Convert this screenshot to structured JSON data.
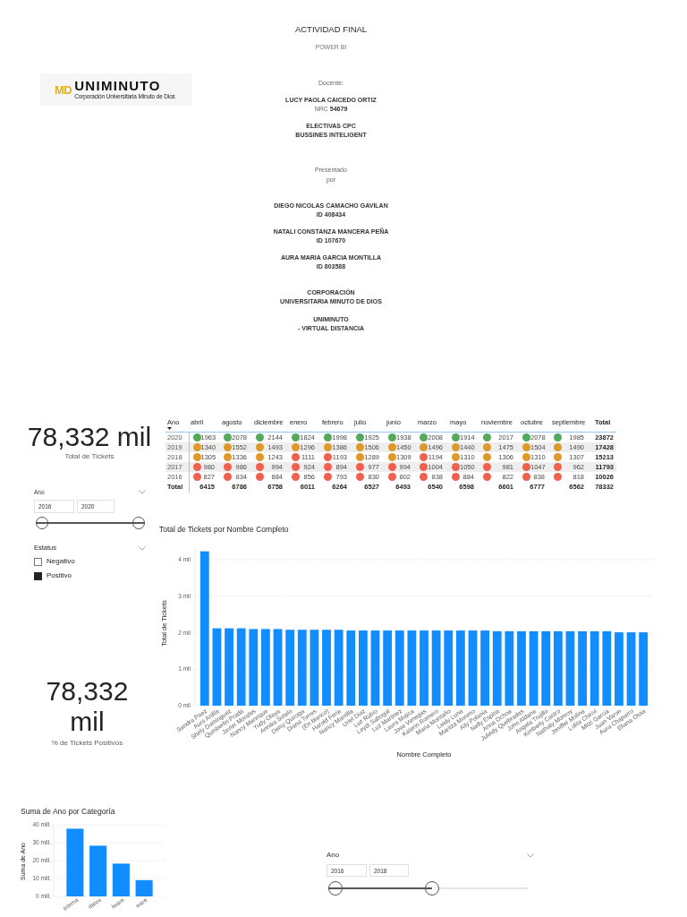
{
  "cover": {
    "logo": {
      "monogram": "MD",
      "name": "UNIMINUTO",
      "tagline": "Corporación Universitaria Minuto de Dios"
    },
    "title": "ACTIVIDAD FINAL",
    "subtitle": "POWER BI",
    "teacher": {
      "label": "Docente:",
      "name": "LUCY PAOLA CAICEDO ORTIZ",
      "nrc": "NRC **54679**"
    },
    "course": [
      "ELECTIVAS CPC",
      "BUSSINES INTELIGENT"
    ],
    "presented_by": [
      "Presentado",
      "por"
    ],
    "students": [
      {
        "name": "DIEGO NICOLAS CAMACHO GAVILAN",
        "id": "ID 408434"
      },
      {
        "name": "NATALI CONSTANZA MANCERA PEÑA",
        "id": "ID 107670"
      },
      {
        "name": "AURA MARIA GARCIA MONTILLA",
        "id": "ID 803588"
      }
    ],
    "institution": [
      "CORPORACIÓN",
      "UNIVERSITARIA MINUTO DE DIOS"
    ],
    "campus": [
      "UNIMINUTO",
      "- VIRTUAL DISTANCIA"
    ]
  },
  "kpis": [
    {
      "value": "78,332 mil",
      "label": "Total de Tickets"
    },
    {
      "value": "78,332 mil",
      "label": "% de Tickets Positivos"
    }
  ],
  "year_slicers": [
    {
      "title": "Ano",
      "from": "2016",
      "to": "2020",
      "level": 1
    },
    {
      "title": "Ano",
      "from": "2016",
      "to": "2018",
      "level": 0.5
    }
  ],
  "status_slicer": {
    "title": "Estatus",
    "options": [
      {
        "label": "Negativo",
        "checked": false
      },
      {
        "label": "Positivo",
        "checked": true
      }
    ]
  },
  "matrix": {
    "columns": [
      {
        "label": "Ano",
        "kind": "row_header",
        "sorted": true
      },
      {
        "label": "abril",
        "kind": "month",
        "sorted": false
      },
      {
        "label": "agosto",
        "kind": "month",
        "sorted": false
      },
      {
        "label": "diciembre",
        "kind": "month",
        "sorted": false
      },
      {
        "label": "enero",
        "kind": "month",
        "sorted": false
      },
      {
        "label": "febrero",
        "kind": "month",
        "sorted": false
      },
      {
        "label": "julio",
        "kind": "month",
        "sorted": false
      },
      {
        "label": "junio",
        "kind": "month",
        "sorted": false
      },
      {
        "label": "marzo",
        "kind": "month",
        "sorted": false
      },
      {
        "label": "mayo",
        "kind": "month",
        "sorted": false
      },
      {
        "label": "noviembre",
        "kind": "month",
        "sorted": false
      },
      {
        "label": "octubre",
        "kind": "month",
        "sorted": false
      },
      {
        "label": "septiembre",
        "kind": "month",
        "sorted": false
      }
    ],
    "total_column": {
      "label": "Total"
    },
    "rows": [
      {
        "cells": [
          {
            "value": "2020"
          },
          {
            "value": "1963",
            "color": "#54a95c"
          },
          {
            "value": "2078",
            "color": "#54a95c"
          },
          {
            "value": "2144",
            "color": "#54a95c"
          },
          {
            "value": "1824",
            "color": "#54a95c"
          },
          {
            "value": "1998",
            "color": "#54a95c"
          },
          {
            "value": "1925",
            "color": "#54a95c"
          },
          {
            "value": "1938",
            "color": "#54a95c"
          },
          {
            "value": "2008",
            "color": "#54a95c"
          },
          {
            "value": "1914",
            "color": "#54a95c"
          },
          {
            "value": "2017",
            "color": "#54a95c"
          },
          {
            "value": "2078",
            "color": "#54a95c"
          },
          {
            "value": "1985",
            "color": "#54a95c"
          }
        ],
        "total": "23872"
      },
      {
        "cells": [
          {
            "value": "2019"
          },
          {
            "value": "1340",
            "color": "#dd9a2a"
          },
          {
            "value": "1552",
            "color": "#dd9a2a"
          },
          {
            "value": "1493",
            "color": "#dd9a2a"
          },
          {
            "value": "1296",
            "color": "#dd9a2a"
          },
          {
            "value": "1386",
            "color": "#dd9a2a"
          },
          {
            "value": "1506",
            "color": "#dd9a2a"
          },
          {
            "value": "1450",
            "color": "#dd9a2a"
          },
          {
            "value": "1496",
            "color": "#dd9a2a"
          },
          {
            "value": "1440",
            "color": "#dd9a2a"
          },
          {
            "value": "1475",
            "color": "#dd9a2a"
          },
          {
            "value": "1504",
            "color": "#dd9a2a"
          },
          {
            "value": "1490",
            "color": "#dd9a2a"
          }
        ],
        "total": "17428"
      },
      {
        "cells": [
          {
            "value": "2018"
          },
          {
            "value": "1305",
            "color": "#dd9a2a"
          },
          {
            "value": "1336",
            "color": "#dd9a2a"
          },
          {
            "value": "1243",
            "color": "#dd9a2a"
          },
          {
            "value": "1111",
            "color": "#f0604e"
          },
          {
            "value": "1193",
            "color": "#f0604e"
          },
          {
            "value": "1289",
            "color": "#dd9a2a"
          },
          {
            "value": "1309",
            "color": "#dd9a2a"
          },
          {
            "value": "1194",
            "color": "#f0604e"
          },
          {
            "value": "1310",
            "color": "#dd9a2a"
          },
          {
            "value": "1306",
            "color": "#dd9a2a"
          },
          {
            "value": "1310",
            "color": "#dd9a2a"
          },
          {
            "value": "1307",
            "color": "#dd9a2a"
          }
        ],
        "total": "15213"
      },
      {
        "cells": [
          {
            "value": "2017"
          },
          {
            "value": "980",
            "color": "#f0604e"
          },
          {
            "value": "986",
            "color": "#f0604e"
          },
          {
            "value": "994",
            "color": "#f0604e"
          },
          {
            "value": "924",
            "color": "#f0604e"
          },
          {
            "value": "894",
            "color": "#f0604e"
          },
          {
            "value": "977",
            "color": "#f0604e"
          },
          {
            "value": "994",
            "color": "#f0604e"
          },
          {
            "value": "1004",
            "color": "#f0604e"
          },
          {
            "value": "1050",
            "color": "#f0604e"
          },
          {
            "value": "981",
            "color": "#f0604e"
          },
          {
            "value": "1047",
            "color": "#f0604e"
          },
          {
            "value": "962",
            "color": "#f0604e"
          }
        ],
        "total": "11793"
      },
      {
        "cells": [
          {
            "value": "2016"
          },
          {
            "value": "827",
            "color": "#f0604e"
          },
          {
            "value": "834",
            "color": "#f0604e"
          },
          {
            "value": "884",
            "color": "#f0604e"
          },
          {
            "value": "856",
            "color": "#f0604e"
          },
          {
            "value": "793",
            "color": "#f0604e"
          },
          {
            "value": "830",
            "color": "#f0604e"
          },
          {
            "value": "802",
            "color": "#f0604e"
          },
          {
            "value": "838",
            "color": "#f0604e"
          },
          {
            "value": "884",
            "color": "#f0604e"
          },
          {
            "value": "822",
            "color": "#f0604e"
          },
          {
            "value": "838",
            "color": "#f0604e"
          },
          {
            "value": "818",
            "color": "#f0604e"
          }
        ],
        "total": "10026"
      }
    ],
    "total_row": {
      "cells": [
        {
          "value": "Total"
        },
        {
          "value": "6415"
        },
        {
          "value": "6786"
        },
        {
          "value": "6758"
        },
        {
          "value": "6011"
        },
        {
          "value": "6264"
        },
        {
          "value": "6527"
        },
        {
          "value": "6493"
        },
        {
          "value": "6540"
        },
        {
          "value": "6598"
        },
        {
          "value": "6601"
        },
        {
          "value": "6777"
        },
        {
          "value": "6562"
        }
      ],
      "total": "78332"
    }
  },
  "tickets_chart": {
    "chart_data": {
      "type": "bar",
      "title": "Total de Tickets por Nombre Completo",
      "xlabel": "Nombre Completo",
      "ylabel": "Total de Tickets",
      "categories": [
        "Sandra Paez",
        "Aura Ardila",
        "Shirly Dominguez",
        "Quinberlin Prada",
        "Javier Morales",
        "Nancy Manrique",
        "Yudy Olaya",
        "Annika Sotelo",
        "Deisy Quiroga",
        "Diana Torres",
        "(En blanco)",
        "Harold Feria",
        "Nancy Mantilla",
        "Uriel Diaz",
        "Luz Rubio",
        "Leydi Sabogal",
        "Luz Martinez",
        "Laura Mojica",
        "Jose Venegas",
        "Katerin Romero",
        "Maria Montaño",
        "Leidy Luna",
        "Maritza Moreno",
        "Aily Polania",
        "Nelly Espitia",
        "Anna Ochoa",
        "Juleidy Quebradas",
        "John Aldana",
        "Angela Trujillo",
        "Kimberly Castro",
        "Nathaly Monroy",
        "Jeniffer Molina",
        "Lolita Chirivi",
        "Mitzi Garcia",
        "Juan Varon",
        "Aura Chaparro",
        "Eliana Ossa"
      ],
      "values": [
        4.23,
        2.12,
        2.12,
        2.12,
        2.1,
        2.1,
        2.1,
        2.08,
        2.08,
        2.08,
        2.08,
        2.08,
        2.06,
        2.06,
        2.06,
        2.06,
        2.06,
        2.06,
        2.06,
        2.06,
        2.06,
        2.06,
        2.06,
        2.06,
        2.04,
        2.04,
        2.04,
        2.04,
        2.04,
        2.04,
        2.04,
        2.04,
        2.04,
        2.04,
        2.01,
        2.01,
        2.01
      ],
      "ylim": [
        0,
        4.3
      ],
      "grid": true,
      "yticks": [
        {
          "value": 0,
          "label": "0 mil"
        },
        {
          "value": 1,
          "label": "1 mil"
        },
        {
          "value": 2,
          "label": "2 mil"
        },
        {
          "value": 3,
          "label": "3 mil"
        },
        {
          "value": 4,
          "label": "4 mil"
        }
      ]
    }
  },
  "category_chart": {
    "chart_data": {
      "type": "bar",
      "title": "Suma de Ano por Categoría",
      "ylabel": "Suma de Ano",
      "categories": [
        "istema",
        "datos",
        "lware",
        "ware"
      ],
      "values": [
        37.8,
        28.3,
        18.3,
        9.1
      ],
      "ylim": [
        0,
        40
      ],
      "grid": true,
      "yticks": [
        {
          "value": 0,
          "label": "0 mill."
        },
        {
          "value": 10,
          "label": "10 mill."
        },
        {
          "value": 20,
          "label": "20 mill."
        },
        {
          "value": 30,
          "label": "30 mill."
        },
        {
          "value": 40,
          "label": "40 mill."
        }
      ]
    }
  }
}
